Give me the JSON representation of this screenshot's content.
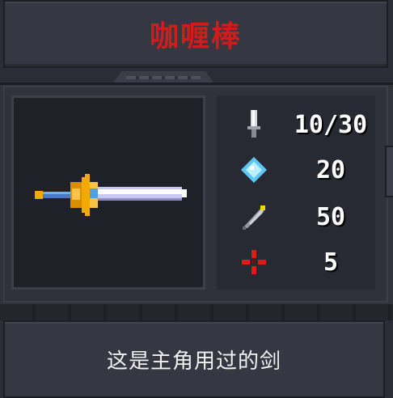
{
  "item": {
    "name": "咖喱棒",
    "description": "这是主角用过的剑"
  },
  "stats": [
    {
      "icon": "sword-damage-icon",
      "value": "10/30"
    },
    {
      "icon": "mana-crystal-icon",
      "value": "20"
    },
    {
      "icon": "feather-speed-icon",
      "value": "50"
    },
    {
      "icon": "crosshair-crit-icon",
      "value": "5"
    }
  ],
  "colors": {
    "title": "#d11c1c",
    "panel": "#353842",
    "weapon_bg": "#1f2128"
  }
}
